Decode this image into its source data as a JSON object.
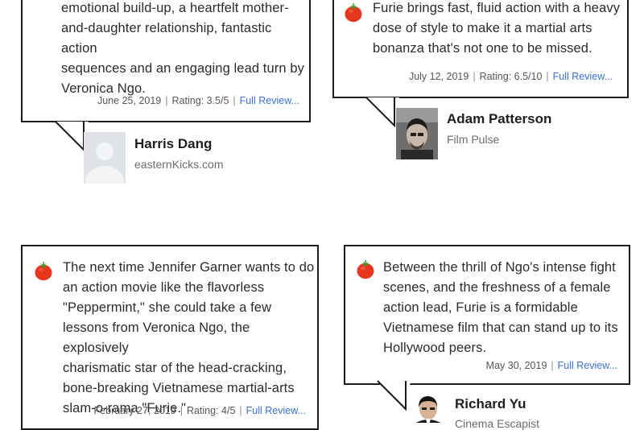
{
  "reviews": [
    {
      "quote": [
        "emotional build-up, a heartfelt mother-",
        "and-daughter relationship, fantastic action",
        "sequences and an engaging lead turn by",
        "Veronica Ngo."
      ],
      "date": "June 25, 2019",
      "rating": "Rating: 3.5/5",
      "link": "Full Review...",
      "critic": "Harris Dang",
      "publication": "easternKicks.com",
      "fresh": false
    },
    {
      "quote": [
        "Furie brings fast, fluid action with a heavy",
        "dose of style to make it a martial arts",
        "bonanza that's not one to be missed."
      ],
      "date": "July 12, 2019",
      "rating": "Rating: 6.5/10",
      "link": "Full Review...",
      "critic": "Adam Patterson",
      "publication": "Film Pulse",
      "fresh": true
    },
    {
      "quote": [
        "The next time Jennifer Garner wants to do",
        "an action movie like the flavorless",
        "\"Peppermint,\" she could take a few",
        "lessons from Veronica Ngo, the explosively",
        "charismatic star of the head-cracking,",
        "bone-breaking Vietnamese martial-arts",
        "slam-o-rama \"Furie.\""
      ],
      "date": "February 27, 2019",
      "rating": "Rating: 4/5",
      "link": "Full Review...",
      "fresh": true
    },
    {
      "quote": [
        "Between the thrill of Ngo's intense fight",
        "scenes, and the freshness of a female",
        "action lead, Furie is a formidable",
        "Vietnamese film that can stand up to its",
        "Hollywood peers."
      ],
      "date": "May 30, 2019",
      "link": "Full Review...",
      "critic": "Richard Yu",
      "publication": "Cinema Escapist",
      "fresh": true
    }
  ],
  "icons": {
    "fresh": "tomato-icon"
  },
  "colors": {
    "tomato": "#e8361e",
    "link": "#3a6fd8",
    "border": "#1b1b1b"
  }
}
